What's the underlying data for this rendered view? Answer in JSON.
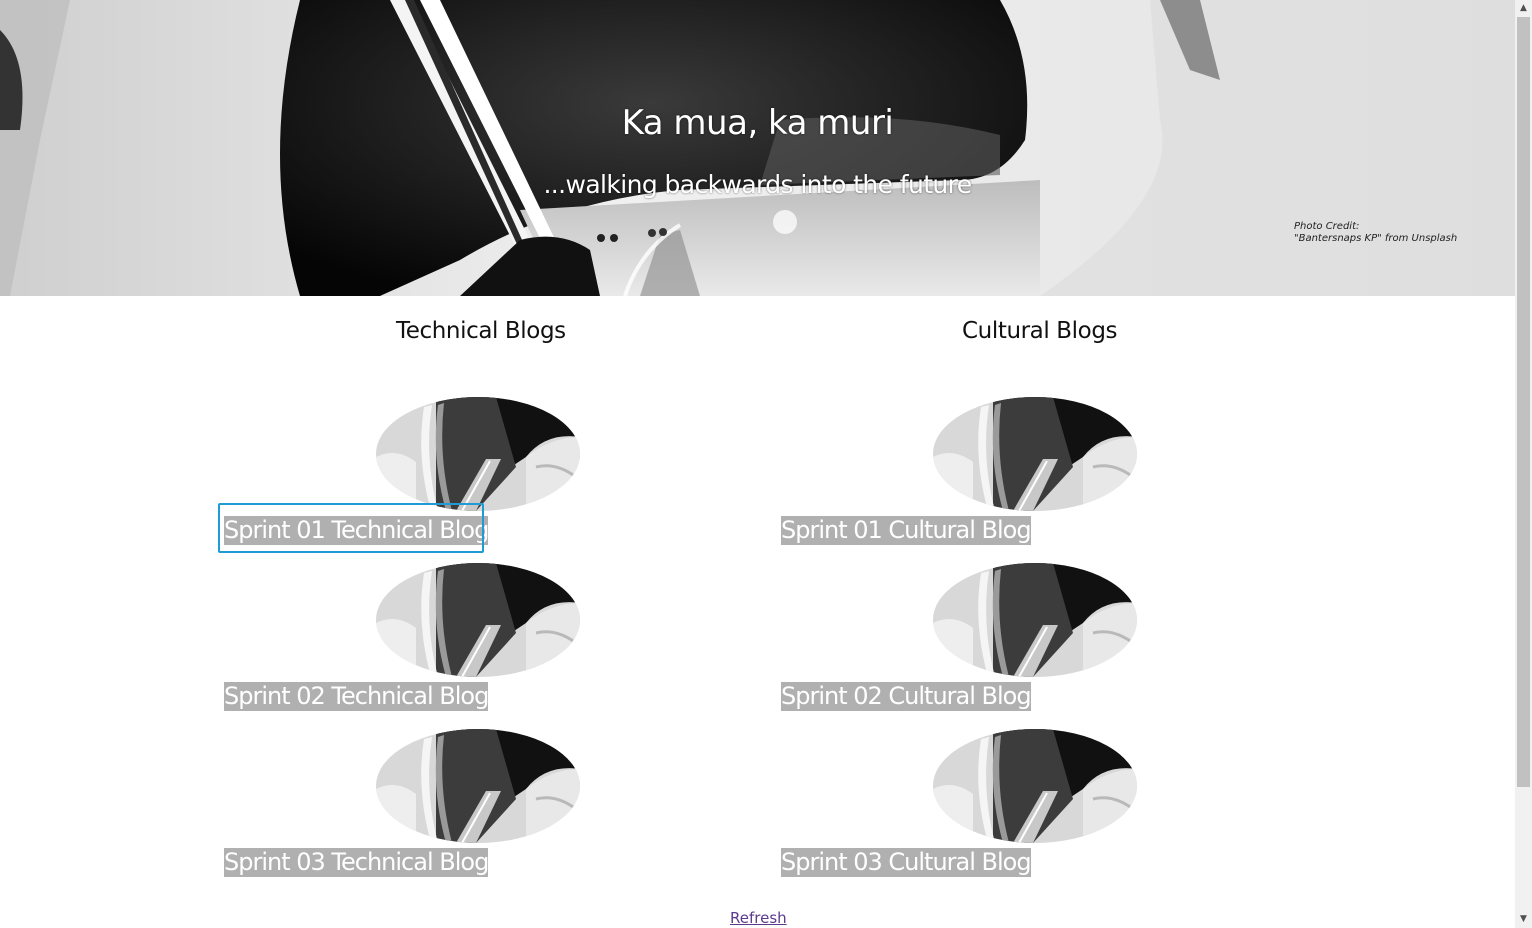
{
  "hero": {
    "title": "Ka mua, ka muri",
    "subtitle": "...walking backwards into the future",
    "photo_credit_line1": "Photo Credit:",
    "photo_credit_line2": "\"Bantersnaps KP\" from Unsplash"
  },
  "columns": {
    "technical": {
      "heading": "Technical Blogs",
      "items": [
        {
          "label": "Sprint 01 Technical Blog"
        },
        {
          "label": "Sprint 02 Technical Blog"
        },
        {
          "label": "Sprint 03 Technical Blog"
        }
      ]
    },
    "cultural": {
      "heading": "Cultural Blogs",
      "items": [
        {
          "label": "Sprint 01 Cultural Blog"
        },
        {
          "label": "Sprint 02 Cultural Blog"
        },
        {
          "label": "Sprint 03 Cultural Blog"
        }
      ]
    }
  },
  "footer": {
    "refresh_label": "Refresh"
  },
  "colors": {
    "link_background": "#b0b0b0",
    "focus_ring": "#1f9bd6",
    "visited_link": "#5b3a8e"
  },
  "icons": {
    "scroll_up": "scroll-up-arrow-icon",
    "scroll_down": "scroll-down-arrow-icon"
  }
}
